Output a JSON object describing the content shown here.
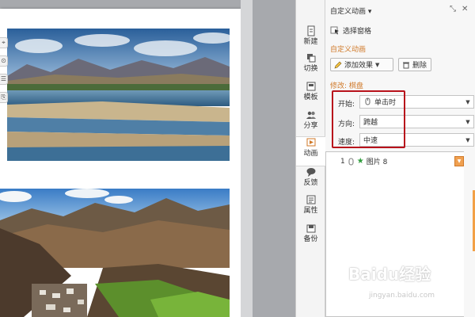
{
  "document": {
    "side_tools": [
      "⌖",
      "⊙",
      "☰",
      "⎘"
    ]
  },
  "tabs": [
    {
      "label": "新建",
      "icon": "new-document-icon"
    },
    {
      "label": "切换",
      "icon": "switch-icon"
    },
    {
      "label": "模板",
      "icon": "template-icon"
    },
    {
      "label": "分享",
      "icon": "share-users-icon"
    },
    {
      "label": "动画",
      "icon": "animation-icon"
    },
    {
      "label": "反馈",
      "icon": "feedback-bubble-icon"
    },
    {
      "label": "属性",
      "icon": "properties-icon"
    },
    {
      "label": "备份",
      "icon": "backup-icon"
    }
  ],
  "panel": {
    "title": "自定义动画 ▾",
    "pin_glyph": "⤡",
    "close_glyph": "✕",
    "select_pane_label": "选择窗格",
    "section_custom": "自定义动画",
    "add_effect_label": "添加效果",
    "delete_label": "删除",
    "section_modify": "修改: 棋盘",
    "start_label": "开始:",
    "start_value": "单击时",
    "direction_label": "方向:",
    "direction_value": "跨越",
    "speed_label": "速度:",
    "speed_value": "中速",
    "dropdown_caret": "▼",
    "anim_item": {
      "index": "1",
      "name": "图片 8"
    }
  },
  "watermark": {
    "logo": "Baidu经验",
    "url": "jingyan.baidu.com"
  },
  "colors": {
    "section_title": "#d07a2a",
    "highlight_border": "#b8121b",
    "effect_star": "#2e9c3b",
    "accent_orange": "#f2a046"
  }
}
